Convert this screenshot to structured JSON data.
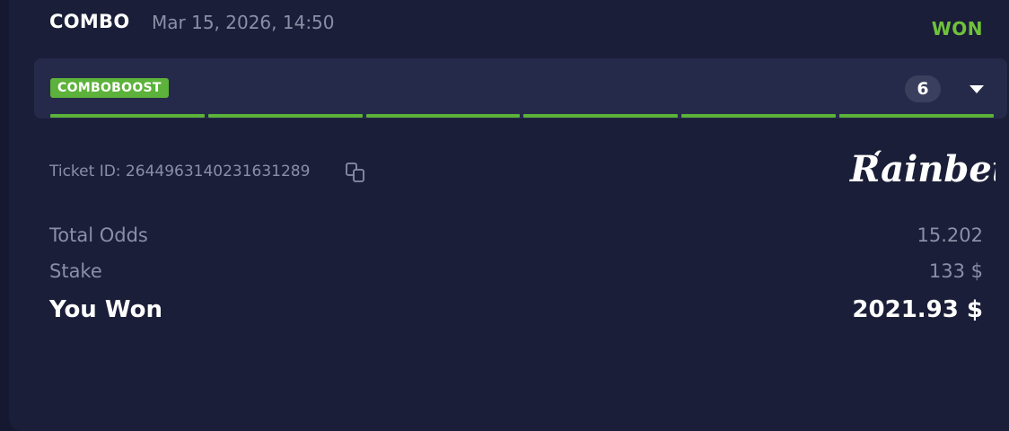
{
  "bet": {
    "type": "COMBO",
    "date": "Mar 15, 2026, 14:50",
    "status": "WON",
    "status_color": "#6fc23b"
  },
  "boost": {
    "badge": "COMBOBOOST",
    "legs_count": "6",
    "legs_completed": 6,
    "legs_total": 6,
    "accent_color": "#5cb23a"
  },
  "ticket": {
    "label": "Ticket ID: 2644963140231631289",
    "copy_icon": "copy-icon"
  },
  "brand": {
    "logo_text": "Rainbet"
  },
  "summary": {
    "total_odds_label": "Total Odds",
    "total_odds_value": "15.202",
    "stake_label": "Stake",
    "stake_value": "133 $",
    "won_label": "You Won",
    "won_value": "2021.93 $"
  }
}
